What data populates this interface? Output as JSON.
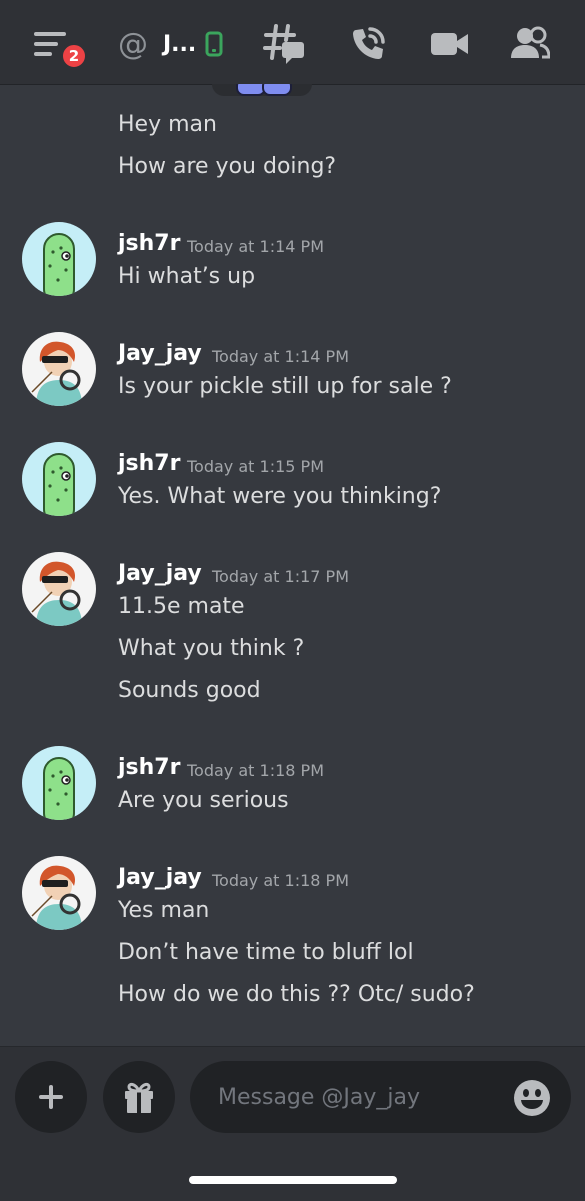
{
  "header": {
    "menu_badge": "2",
    "dm_name": "J...",
    "icons": [
      "menu-icon",
      "at-icon",
      "mobile-status-icon",
      "threads-icon",
      "call-icon",
      "video-icon",
      "members-icon"
    ]
  },
  "messages": {
    "continued": [
      "Hey man",
      "How are you doing?"
    ],
    "groups": [
      {
        "author": "jsh7r",
        "timestamp": "Today at 1:14 PM",
        "lines": [
          "Hi what’s up"
        ]
      },
      {
        "author": "Jay_jay",
        "timestamp": "Today at 1:14 PM",
        "lines": [
          "Is your pickle still up for sale ?"
        ]
      },
      {
        "author": "jsh7r",
        "timestamp": "Today at 1:15 PM",
        "lines": [
          "Yes. What were you thinking?"
        ]
      },
      {
        "author": "Jay_jay",
        "timestamp": "Today at 1:17 PM",
        "lines": [
          "11.5e mate",
          "What you think ?",
          "Sounds good"
        ]
      },
      {
        "author": "jsh7r",
        "timestamp": "Today at 1:18 PM",
        "lines": [
          "Are you serious"
        ]
      },
      {
        "author": "Jay_jay",
        "timestamp": "Today at 1:18 PM",
        "lines": [
          "Yes man",
          "Don’t have time to bluff lol",
          "How do we do this ?? Otc/ sudo?"
        ]
      }
    ]
  },
  "composer": {
    "placeholder": "Message @Jay_jay",
    "icons": [
      "plus-icon",
      "gift-icon",
      "emoji-icon"
    ]
  },
  "colors": {
    "background": "#36393f",
    "header": "#2f3136",
    "badge": "#ed4245",
    "online_mobile": "#3ba55d"
  }
}
